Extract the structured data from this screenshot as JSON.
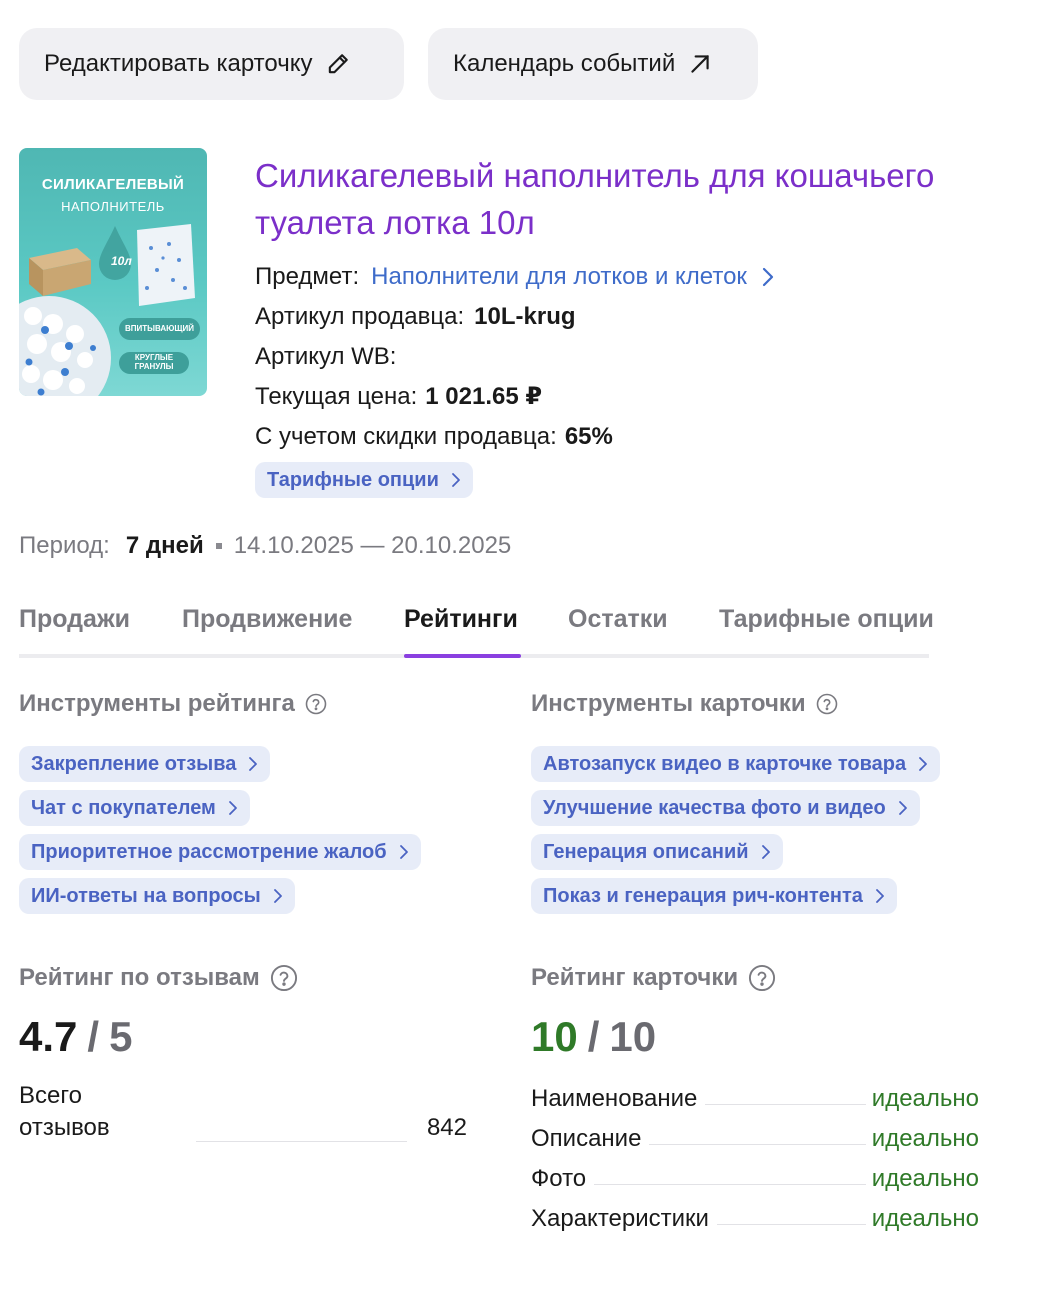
{
  "toolbar": {
    "edit_label": "Редактировать карточку",
    "calendar_label": "Календарь событий"
  },
  "product": {
    "title": "Силикагелевый наполнитель для кошачьего туалета лотка 10л",
    "image": {
      "line1": "СИЛИКАГЕЛЕВЫЙ",
      "line2": "НАПОЛНИТЕЛЬ",
      "volume": "10л",
      "badge1": "ВПИТЫВАЮЩИЙ",
      "badge2": "КРУГЛЫЕ ГРАНУЛЫ"
    },
    "subject_label": "Предмет:",
    "subject_value": "Наполнители для лотков и клеток",
    "seller_sku_label": "Артикул продавца:",
    "seller_sku_value": "10L-krug",
    "wb_sku_label": "Артикул WB:",
    "price_label": "Текущая цена:",
    "price_value": "1 021.65 ₽",
    "discount_label": "С учетом скидки продавца:",
    "discount_value": "65%",
    "tariff_chip": "Тарифные опции"
  },
  "period": {
    "label": "Период:",
    "value": "7 дней",
    "range": "14.10.2025 — 20.10.2025"
  },
  "tabs": [
    {
      "label": "Продажи"
    },
    {
      "label": "Продвижение"
    },
    {
      "label": "Рейтинги"
    },
    {
      "label": "Остатки"
    },
    {
      "label": "Тарифные опции"
    }
  ],
  "active_tab": "Рейтинги",
  "rating_tools": {
    "title": "Инструменты рейтинга",
    "items": [
      {
        "label": "Закрепление отзыва"
      },
      {
        "label": "Чат с покупателем"
      },
      {
        "label": "Приоритетное рассмотрение жалоб"
      },
      {
        "label": "ИИ-ответы на вопросы"
      }
    ]
  },
  "card_tools": {
    "title": "Инструменты карточки",
    "items": [
      {
        "label": "Автозапуск видео в карточке товара"
      },
      {
        "label": "Улучшение качества фото и видео"
      },
      {
        "label": "Генерация описаний"
      },
      {
        "label": "Показ и генерация рич-контента"
      }
    ]
  },
  "review_rating": {
    "title": "Рейтинг по отзывам",
    "value": "4.7",
    "separator": "/",
    "max": "5",
    "total_label": "Всего отзывов",
    "total_value": "842"
  },
  "card_rating": {
    "title": "Рейтинг карточки",
    "value": "10",
    "separator": "/",
    "max": "10",
    "rows": [
      {
        "name": "Наименование",
        "status": "идеально"
      },
      {
        "name": "Описание",
        "status": "идеально"
      },
      {
        "name": "Фото",
        "status": "идеально"
      },
      {
        "name": "Характеристики",
        "status": "идеально"
      }
    ]
  },
  "colors": {
    "title_purple": "#7b2fc9",
    "link_blue": "#3e6bc9",
    "chip_bg": "#e7ecf8",
    "chip_text": "#4a63c2",
    "tab_accent": "#8a3fe0",
    "good_green": "#2f7a28"
  },
  "icons": {
    "edit": "pencil-icon",
    "calendar": "arrow-up-right-icon",
    "chevron": "chevron-right-icon",
    "help": "question-circle-icon"
  }
}
